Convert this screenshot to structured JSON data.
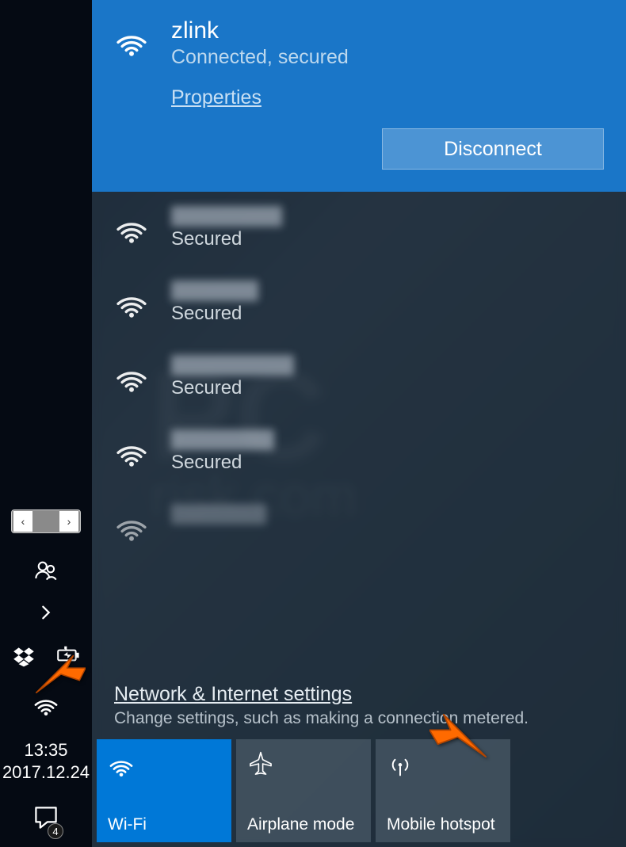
{
  "connected": {
    "name": "zlink",
    "status": "Connected, secured",
    "properties_label": "Properties",
    "disconnect_label": "Disconnect"
  },
  "networks": [
    {
      "secured_label": "Secured"
    },
    {
      "secured_label": "Secured"
    },
    {
      "secured_label": "Secured"
    },
    {
      "secured_label": "Secured"
    },
    {
      "secured_label": ""
    }
  ],
  "settings": {
    "link": "Network & Internet settings",
    "desc": "Change settings, such as making a connection metered."
  },
  "tiles": {
    "wifi": "Wi-Fi",
    "airplane": "Airplane mode",
    "hotspot": "Mobile hotspot"
  },
  "clock": {
    "time": "13:35",
    "date": "2017.12.24"
  },
  "action_center": {
    "badge": "4"
  },
  "lang": {
    "left": "‹",
    "right": "›"
  }
}
